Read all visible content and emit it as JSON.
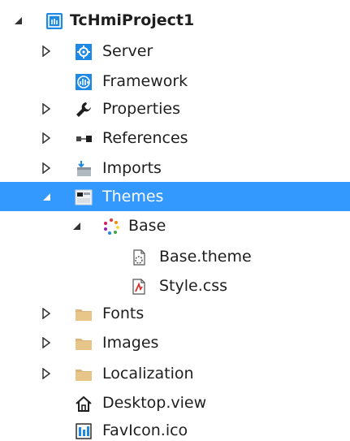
{
  "tree": {
    "items": [
      {
        "label": "TcHmiProject1",
        "icon": "project-icon",
        "state": "expanded"
      },
      {
        "label": "Server",
        "icon": "server-gear-icon",
        "state": "collapsed"
      },
      {
        "label": "Framework",
        "icon": "framework-icon",
        "state": "none"
      },
      {
        "label": "Properties",
        "icon": "wrench-icon",
        "state": "collapsed"
      },
      {
        "label": "References",
        "icon": "references-icon",
        "state": "collapsed"
      },
      {
        "label": "Imports",
        "icon": "imports-icon",
        "state": "collapsed"
      },
      {
        "label": "Themes",
        "icon": "themes-icon",
        "state": "expanded",
        "selected": true
      },
      {
        "label": "Base",
        "icon": "palette-icon",
        "state": "expanded"
      },
      {
        "label": "Base.theme",
        "icon": "theme-file-icon",
        "state": "none"
      },
      {
        "label": "Style.css",
        "icon": "css-file-icon",
        "state": "none"
      },
      {
        "label": "Fonts",
        "icon": "folder-icon",
        "state": "collapsed"
      },
      {
        "label": "Images",
        "icon": "folder-icon",
        "state": "collapsed"
      },
      {
        "label": "Localization",
        "icon": "folder-icon",
        "state": "collapsed"
      },
      {
        "label": "Desktop.view",
        "icon": "home-icon",
        "state": "none"
      },
      {
        "label": "FavIcon.ico",
        "icon": "ico-file-icon",
        "state": "none"
      }
    ]
  },
  "colors": {
    "selection": "#3399ff",
    "accent_blue": "#1e88e5",
    "folder": "#dcb67a"
  }
}
